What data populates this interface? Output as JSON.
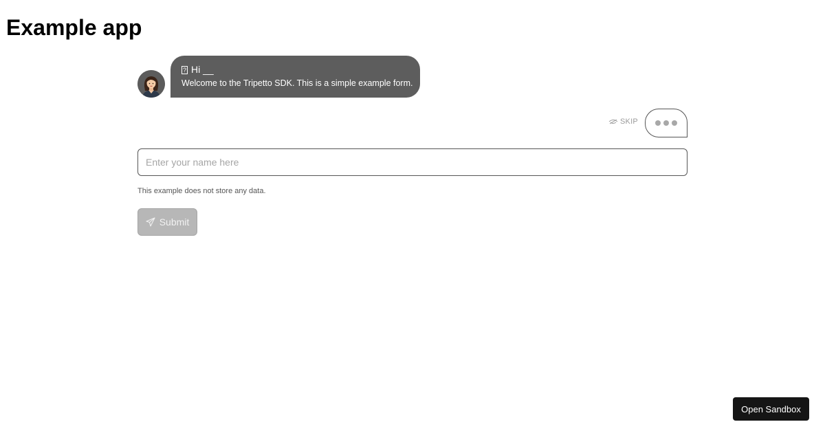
{
  "app": {
    "title": "Example app"
  },
  "bot_message": {
    "title": "Hi __",
    "text": "Welcome to the Tripetto SDK. This is a simple example form.",
    "avatar_icon": "woman-avatar-icon"
  },
  "skip": {
    "label": "SKIP",
    "icon": "eye-slash-icon"
  },
  "typing_indicator": {
    "icon": "ellipsis-dots-icon"
  },
  "name_input": {
    "value": "",
    "placeholder": "Enter your name here"
  },
  "note": {
    "text": "This example does not store any data."
  },
  "submit": {
    "label": "Submit",
    "icon": "paper-plane-icon",
    "state": "disabled"
  },
  "sandbox": {
    "label": "Open Sandbox"
  },
  "colors": {
    "bubble": "#5d5d5d",
    "submit_disabled": "#b7b7b7",
    "sandbox_button": "#151515",
    "text": "#000000"
  }
}
